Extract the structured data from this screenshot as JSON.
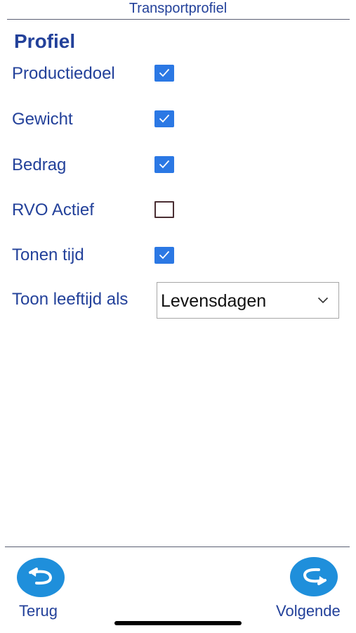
{
  "header": {
    "title": "Transportprofiel"
  },
  "section": {
    "title": "Profiel"
  },
  "rows": [
    {
      "label": "Productiedoel",
      "checked": true
    },
    {
      "label": "Gewicht",
      "checked": true
    },
    {
      "label": "Bedrag",
      "checked": true
    },
    {
      "label": "RVO Actief",
      "checked": false
    },
    {
      "label": "Tonen tijd",
      "checked": true
    }
  ],
  "age_display": {
    "label": "Toon leeftijd als",
    "selected": "Levensdagen"
  },
  "footer": {
    "back_label": "Terug",
    "next_label": "Volgende"
  },
  "colors": {
    "accent_text": "#23419a",
    "checkbox_checked": "#2b78e4",
    "nav_button": "#1f8fdb"
  },
  "icons": {
    "checkbox_check": "check-icon",
    "dropdown": "chevron-down-icon",
    "back": "arrow-back-icon",
    "next": "arrow-forward-icon"
  }
}
